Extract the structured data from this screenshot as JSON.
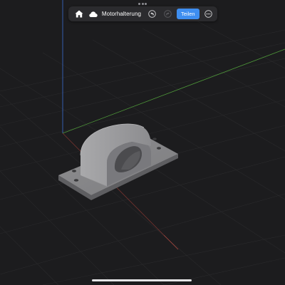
{
  "toolbar": {
    "home_icon": "home-icon",
    "cloud_icon": "cloud-icon",
    "title": "Motorhalterung",
    "undo_icon": "undo-icon",
    "redo_icon": "redo-icon",
    "share_label": "Teilen",
    "more_icon": "more-icon",
    "accent_color": "#3e8ef0"
  },
  "viewport": {
    "background": "#1c1c1e",
    "axis_colors": {
      "x": "#b0473f",
      "y": "#4f9a3a",
      "z": "#3d6fd1"
    },
    "model_name": "motor-mount-model"
  }
}
